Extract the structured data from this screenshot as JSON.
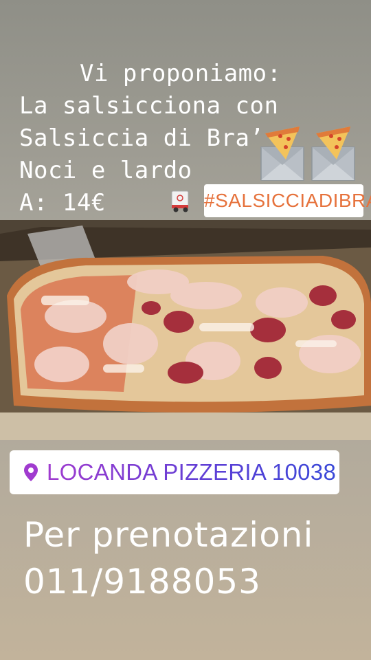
{
  "story": {
    "intro": "Vi proponiamo:",
    "line2": "La salsicciona con",
    "line3": "Salsiccia di Bra’",
    "line4": "Noci e lardo",
    "price": "A: 14€"
  },
  "hashtag": "#SALSICCIADIBRA",
  "location": {
    "label": "LOCANDA PIZZERIA 10038",
    "icon": "location-pin-icon"
  },
  "booking": {
    "line1": "Per prenotazioni",
    "phone": "011/9188053"
  },
  "icons": [
    "pizza-envelope-icon",
    "pizza-envelope-icon",
    "delivery-truck-icon"
  ],
  "colors": {
    "hashtag": "#e6723c",
    "location_gradient_start": "#a03bcf",
    "location_gradient_end": "#3a49d8"
  }
}
